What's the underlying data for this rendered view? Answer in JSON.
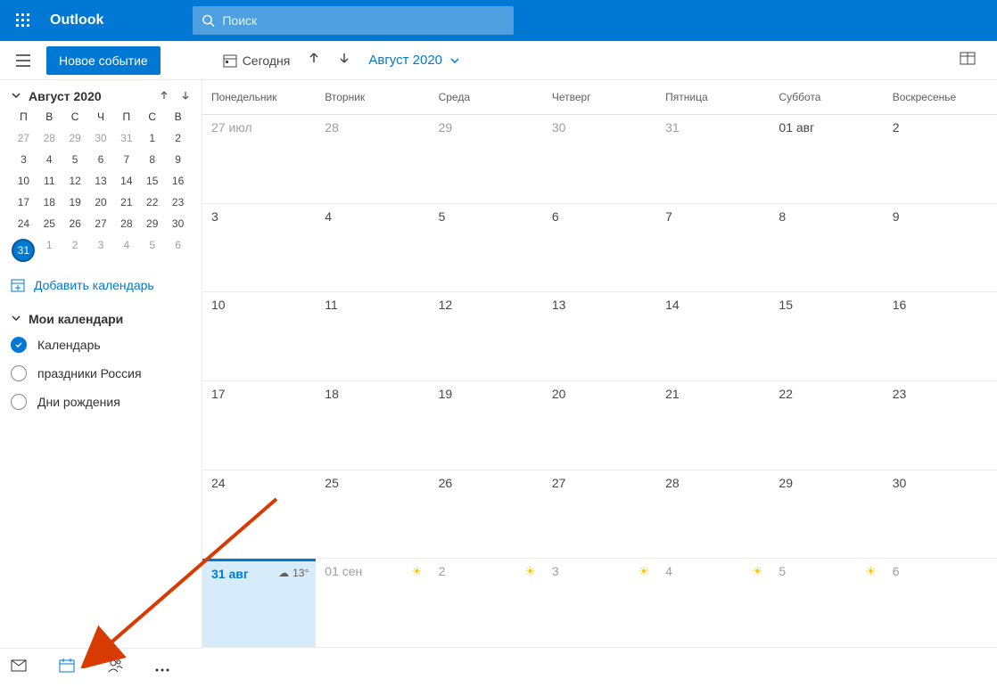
{
  "app_name": "Outlook",
  "search_placeholder": "Поиск",
  "toolbar": {
    "new_event": "Новое событие",
    "today": "Сегодня",
    "month_label": "Август 2020"
  },
  "mini_calendar": {
    "title": "Август 2020",
    "dow": [
      "П",
      "В",
      "С",
      "Ч",
      "П",
      "С",
      "В"
    ],
    "rows": [
      [
        {
          "n": "27",
          "dim": true
        },
        {
          "n": "28",
          "dim": true
        },
        {
          "n": "29",
          "dim": true
        },
        {
          "n": "30",
          "dim": true
        },
        {
          "n": "31",
          "dim": true
        },
        {
          "n": "1"
        },
        {
          "n": "2"
        }
      ],
      [
        {
          "n": "3"
        },
        {
          "n": "4"
        },
        {
          "n": "5"
        },
        {
          "n": "6"
        },
        {
          "n": "7"
        },
        {
          "n": "8"
        },
        {
          "n": "9"
        }
      ],
      [
        {
          "n": "10"
        },
        {
          "n": "11"
        },
        {
          "n": "12"
        },
        {
          "n": "13"
        },
        {
          "n": "14"
        },
        {
          "n": "15"
        },
        {
          "n": "16"
        }
      ],
      [
        {
          "n": "17"
        },
        {
          "n": "18"
        },
        {
          "n": "19"
        },
        {
          "n": "20"
        },
        {
          "n": "21"
        },
        {
          "n": "22"
        },
        {
          "n": "23"
        }
      ],
      [
        {
          "n": "24"
        },
        {
          "n": "25"
        },
        {
          "n": "26"
        },
        {
          "n": "27"
        },
        {
          "n": "28"
        },
        {
          "n": "29"
        },
        {
          "n": "30"
        }
      ],
      [
        {
          "n": "31",
          "sel": true
        },
        {
          "n": "1",
          "dim": true
        },
        {
          "n": "2",
          "dim": true
        },
        {
          "n": "3",
          "dim": true
        },
        {
          "n": "4",
          "dim": true
        },
        {
          "n": "5",
          "dim": true
        },
        {
          "n": "6",
          "dim": true
        }
      ]
    ]
  },
  "add_calendar": "Добавить календарь",
  "my_calendars_label": "Мои календари",
  "calendars": [
    {
      "label": "Календарь",
      "checked": true
    },
    {
      "label": "праздники Россия",
      "checked": false
    },
    {
      "label": "Дни рождения",
      "checked": false
    }
  ],
  "dow_headers": [
    "Понедельник",
    "Вторник",
    "Среда",
    "Четверг",
    "Пятница",
    "Суббота",
    "Воскресенье"
  ],
  "weeks": [
    [
      {
        "t": "27 июл",
        "dim": true
      },
      {
        "t": "28",
        "dim": true
      },
      {
        "t": "29",
        "dim": true
      },
      {
        "t": "30",
        "dim": true
      },
      {
        "t": "31",
        "dim": true
      },
      {
        "t": "01 авг"
      },
      {
        "t": "2"
      }
    ],
    [
      {
        "t": "3"
      },
      {
        "t": "4"
      },
      {
        "t": "5"
      },
      {
        "t": "6"
      },
      {
        "t": "7"
      },
      {
        "t": "8"
      },
      {
        "t": "9"
      }
    ],
    [
      {
        "t": "10"
      },
      {
        "t": "11"
      },
      {
        "t": "12"
      },
      {
        "t": "13"
      },
      {
        "t": "14"
      },
      {
        "t": "15"
      },
      {
        "t": "16"
      }
    ],
    [
      {
        "t": "17"
      },
      {
        "t": "18"
      },
      {
        "t": "19"
      },
      {
        "t": "20"
      },
      {
        "t": "21"
      },
      {
        "t": "22"
      },
      {
        "t": "23"
      }
    ],
    [
      {
        "t": "24"
      },
      {
        "t": "25"
      },
      {
        "t": "26"
      },
      {
        "t": "27"
      },
      {
        "t": "28"
      },
      {
        "t": "29"
      },
      {
        "t": "30"
      }
    ],
    [
      {
        "t": "31 авг",
        "today": true,
        "weather": "13°",
        "cloud": true
      },
      {
        "t": "01 сен",
        "dim": true,
        "sun": true
      },
      {
        "t": "2",
        "dim": true,
        "sun": true
      },
      {
        "t": "3",
        "dim": true,
        "sun": true
      },
      {
        "t": "4",
        "dim": true,
        "sun": true
      },
      {
        "t": "5",
        "dim": true,
        "sun": true
      },
      {
        "t": "6",
        "dim": true
      }
    ]
  ]
}
